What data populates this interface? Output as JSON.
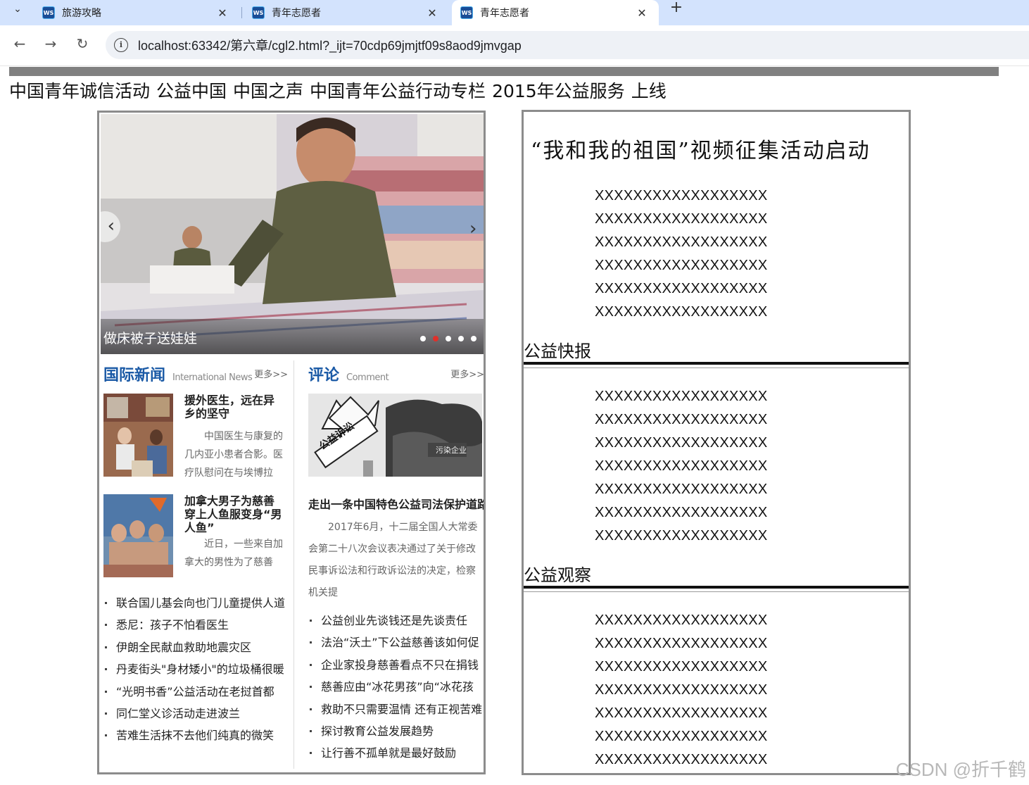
{
  "browser": {
    "tabs": [
      {
        "label": "旅游攻略",
        "icon": "webstorm-icon",
        "active": false
      },
      {
        "label": "青年志愿者",
        "icon": "webstorm-icon",
        "active": false
      },
      {
        "label": "青年志愿者",
        "icon": "webstorm-icon",
        "active": true
      }
    ],
    "favicon_text": "WS",
    "url": "localhost:63342/第六章/cgl2.html?_ijt=70cdp69jmjtf09s8aod9jmvgap"
  },
  "nav": {
    "links": [
      "中国青年诚信活动",
      "公益中国",
      "中国之声",
      "中国青年公益行动专栏",
      "2015年公益服务",
      "上线"
    ]
  },
  "slider": {
    "caption": "做床被子送娃娃",
    "dot_count": 5,
    "active_dot": 1
  },
  "intl_news": {
    "title": "国际新闻",
    "subtitle": "International News",
    "more": "更多>>",
    "items": [
      {
        "title": "援外医生，远在异乡的坚守",
        "summary": "中国医生与康复的几内亚小患者合影。医疗队慰问在与埃博拉"
      },
      {
        "title": "加拿大男子为慈善穿上人鱼服变身“男人鱼”",
        "summary": "近日，一些来自加拿大的男性为了慈善"
      }
    ],
    "list": [
      "联合国儿基会向也门儿童提供人道",
      "悉尼：孩子不怕看医生",
      "伊朗全民献血救助地震灾区",
      "丹麦街头\"身材矮小\"的垃圾桶很暖",
      "“光明书香”公益活动在老挝首都",
      "同仁堂义诊活动走进波兰",
      "苦难生活抹不去他们纯真的微笑"
    ]
  },
  "comment": {
    "title": "评论",
    "subtitle": "Comment",
    "more": "更多>>",
    "image_sign": "公益诉讼",
    "image_label": "污染企业",
    "headline": "走出一条中国特色公益司法保护道路",
    "summary": "2017年6月，十二届全国人大常委会第二十八次会议表决通过了关于修改民事诉讼法和行政诉讼法的决定，检察机关提",
    "list": [
      "公益创业先谈钱还是先谈责任",
      "法治“沃土”下公益慈善该如何促",
      "企业家投身慈善看点不只在捐钱",
      "慈善应由“冰花男孩”向“冰花孩",
      "救助不只需要温情 还有正视苦难",
      "探讨教育公益发展趋势",
      "让行善不孤单就是最好鼓励"
    ]
  },
  "right": {
    "title": "“我和我的祖国”视频征集活动启动",
    "block1": [
      "XXXXXXXXXXXXXXXXXX",
      "XXXXXXXXXXXXXXXXXX",
      "XXXXXXXXXXXXXXXXXX",
      "XXXXXXXXXXXXXXXXXX",
      "XXXXXXXXXXXXXXXXXX",
      "XXXXXXXXXXXXXXXXXX"
    ],
    "section2": "公益快报",
    "block2": [
      "XXXXXXXXXXXXXXXXXX",
      "XXXXXXXXXXXXXXXXXX",
      "XXXXXXXXXXXXXXXXXX",
      "XXXXXXXXXXXXXXXXXX",
      "XXXXXXXXXXXXXXXXXX",
      "XXXXXXXXXXXXXXXXXX",
      "XXXXXXXXXXXXXXXXXX"
    ],
    "section3": "公益观察",
    "block3": [
      "XXXXXXXXXXXXXXXXXX",
      "XXXXXXXXXXXXXXXXXX",
      "XXXXXXXXXXXXXXXXXX",
      "XXXXXXXXXXXXXXXXXX",
      "XXXXXXXXXXXXXXXXXX",
      "XXXXXXXXXXXXXXXXXX",
      "XXXXXXXXXXXXXXXXXX"
    ]
  },
  "watermark": "CSDN @折千鹤"
}
